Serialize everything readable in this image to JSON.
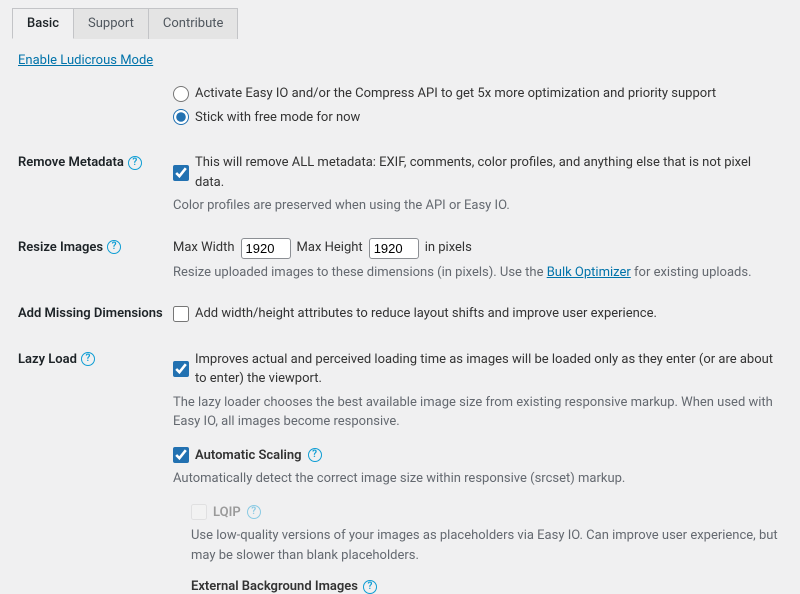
{
  "tabs": {
    "basic": "Basic",
    "support": "Support",
    "contribute": "Contribute"
  },
  "ludicrous_link": "Enable Ludicrous Mode",
  "top_radios": {
    "opt1": "Activate Easy IO and/or the Compress API to get 5x more optimization and priority support",
    "opt2": "Stick with free mode for now"
  },
  "sections": {
    "remove_metadata": {
      "label": "Remove Metadata",
      "check_text": "This will remove ALL metadata: EXIF, comments, color profiles, and anything else that is not pixel data.",
      "desc": "Color profiles are preserved when using the API or Easy IO."
    },
    "resize": {
      "label": "Resize Images",
      "max_width_label": "Max Width",
      "max_width_value": "1920",
      "max_height_label": "Max Height",
      "max_height_value": "1920",
      "unit": "in pixels",
      "desc_pre": "Resize uploaded images to these dimensions (in pixels). Use the ",
      "desc_link": "Bulk Optimizer",
      "desc_post": " for existing uploads."
    },
    "add_dims": {
      "label": "Add Missing Dimensions",
      "check_text": "Add width/height attributes to reduce layout shifts and improve user experience."
    },
    "lazy": {
      "label": "Lazy Load",
      "check_text": "Improves actual and perceived loading time as images will be loaded only as they enter (or are about to enter) the viewport.",
      "desc": "The lazy loader chooses the best available image size from existing responsive markup. When used with Easy IO, all images become responsive.",
      "auto_scale": {
        "label": "Automatic Scaling",
        "desc": "Automatically detect the correct image size within responsive (srcset) markup."
      },
      "lqip": {
        "label": "LQIP",
        "desc": "Use low-quality versions of your images as placeholders via Easy IO. Can improve user experience, but may be slower than blank placeholders."
      },
      "ext_bg": "External Background Images"
    }
  }
}
